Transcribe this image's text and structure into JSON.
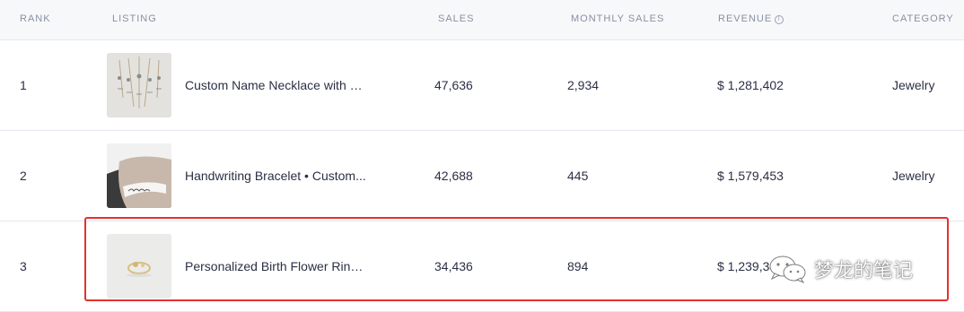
{
  "table": {
    "headers": {
      "rank": "RANK",
      "listing": "LISTING",
      "sales": "SALES",
      "monthly_sales": "MONTHLY SALES",
      "revenue": "REVENUE",
      "revenue_info_icon": "info-icon",
      "category": "CATEGORY"
    },
    "rows": [
      {
        "rank": "1",
        "listing": "Custom Name Necklace with B...",
        "sales": "47,636",
        "monthly_sales": "2,934",
        "revenue": "$ 1,281,402",
        "category": "Jewelry"
      },
      {
        "rank": "2",
        "listing": "Handwriting Bracelet • Custom...",
        "sales": "42,688",
        "monthly_sales": "445",
        "revenue": "$ 1,579,453",
        "category": "Jewelry"
      },
      {
        "rank": "3",
        "listing": "Personalized Birth Flower Ring ...",
        "sales": "34,436",
        "monthly_sales": "894",
        "revenue": "$ 1,239,34",
        "category": ""
      }
    ]
  },
  "watermark": {
    "text": "梦龙的笔记",
    "icon": "wechat-icon"
  },
  "colors": {
    "highlight_border": "#e5302e",
    "header_bg": "#f7f8fa",
    "text": "#2b2f45",
    "header_text": "#8a8fa3"
  }
}
